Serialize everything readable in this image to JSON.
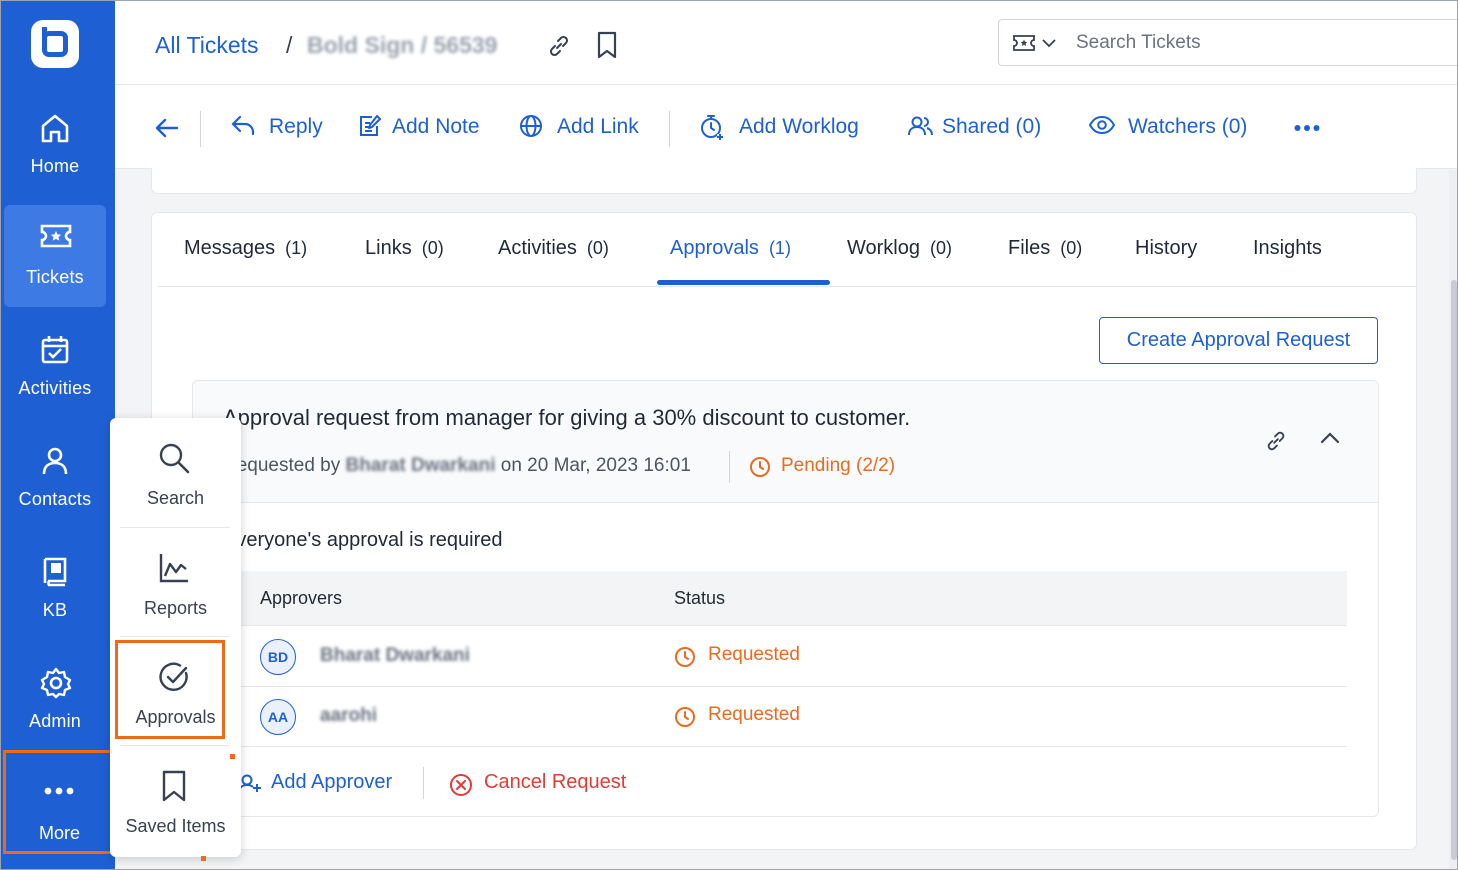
{
  "sidebar": {
    "items": [
      {
        "label": "Home"
      },
      {
        "label": "Tickets"
      },
      {
        "label": "Activities"
      },
      {
        "label": "Contacts"
      },
      {
        "label": "KB"
      },
      {
        "label": "Admin"
      },
      {
        "label": "More"
      }
    ]
  },
  "header": {
    "breadcrumb_root": "All Tickets",
    "breadcrumb_sep": "/",
    "breadcrumb_redacted": "Bold Sign / 56539",
    "search_placeholder": "Search Tickets"
  },
  "actions": {
    "reply": "Reply",
    "add_note": "Add Note",
    "add_link": "Add Link",
    "add_worklog": "Add Worklog",
    "shared": "Shared (0)",
    "watchers": "Watchers (0)"
  },
  "tabs": [
    {
      "label": "Messages",
      "count": "(1)"
    },
    {
      "label": "Links",
      "count": "(0)"
    },
    {
      "label": "Activities",
      "count": "(0)"
    },
    {
      "label": "Approvals",
      "count": "(1)"
    },
    {
      "label": "Worklog",
      "count": "(0)"
    },
    {
      "label": "Files",
      "count": "(0)"
    },
    {
      "label": "History",
      "count": ""
    },
    {
      "label": "Insights",
      "count": ""
    }
  ],
  "approvals": {
    "create_button": "Create Approval Request",
    "title": "Approval request from manager for giving a 30% discount to customer.",
    "requested_by_prefix": "Requested by",
    "requester_redacted": "Bharat Dwarkani",
    "requested_on": "on 20 Mar, 2023 16:01",
    "status": "Pending (2/2)",
    "rule_text": "Everyone's approval is required",
    "columns": {
      "approvers": "Approvers",
      "status": "Status"
    },
    "rows": [
      {
        "initials": "BD",
        "name": "Bharat Dwarkani",
        "status": "Requested"
      },
      {
        "initials": "AA",
        "name": "aarohi",
        "status": "Requested"
      }
    ],
    "add_approver": "Add Approver",
    "cancel_request": "Cancel Request"
  },
  "more_menu": {
    "items": [
      {
        "label": "Search"
      },
      {
        "label": "Reports"
      },
      {
        "label": "Approvals"
      },
      {
        "label": "Saved Items"
      }
    ]
  },
  "colors": {
    "brand": "#1e5fd4",
    "highlight": "#ee6a1a",
    "pending": "#ea6a1f",
    "danger": "#e53935"
  }
}
